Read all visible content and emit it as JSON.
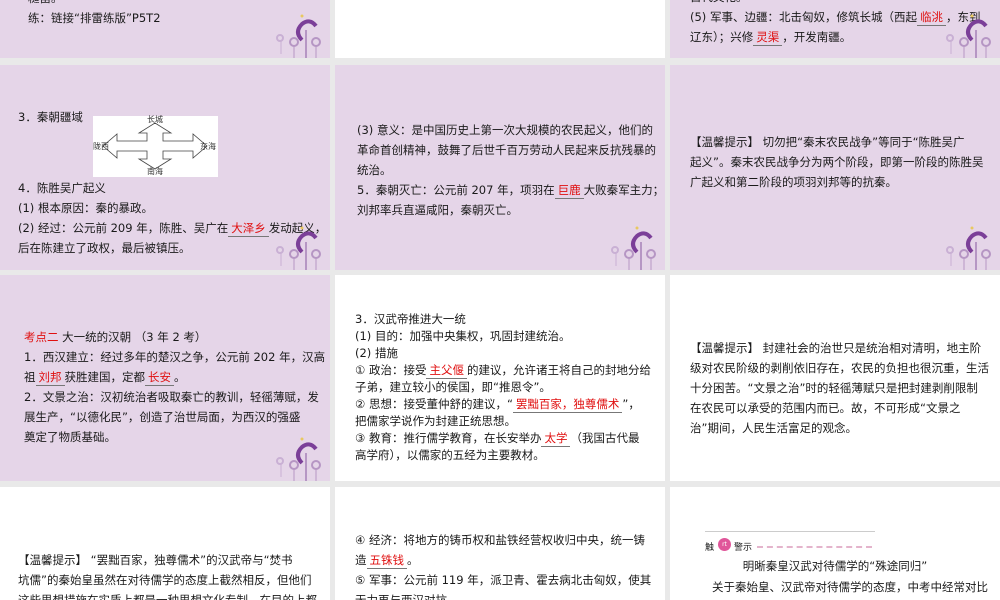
{
  "cells": {
    "r1c1": {
      "lines": [
        [
          {
            "t": "糙笛。"
          }
        ],
        [
          {
            "t": "练：链接“排雷练版”P5T2"
          }
        ]
      ]
    },
    "r1c3": {
      "lines": [
        [
          {
            "t": "古代文化。"
          }
        ],
        [
          {
            "t": "(5) 军事、边疆：北击匈奴，修筑长城（西起"
          },
          {
            "t": "临洮",
            "blank": true
          },
          {
            "t": "，东到"
          }
        ],
        [
          {
            "t": "辽东）；兴修"
          },
          {
            "t": "灵渠",
            "blank": true
          },
          {
            "t": "，开发南疆。"
          }
        ]
      ]
    },
    "r2c1": {
      "lines_top": [
        [
          {
            "t": "3．秦朝疆域"
          }
        ]
      ],
      "map": {
        "north": "长城",
        "west": "陇西",
        "east": "东海",
        "south": "南海"
      },
      "lines": [
        [
          {
            "t": "4．陈胜吴广起义"
          }
        ],
        [
          {
            "t": "(1) 根本原因：秦的暴政。"
          }
        ],
        [
          {
            "t": "(2) 经过：公元前 209 年，陈胜、吴广在"
          },
          {
            "t": "大泽乡",
            "blank": true
          },
          {
            "t": "发动起义，"
          }
        ],
        [
          {
            "t": "后在陈建立了政权，最后被镇压。"
          }
        ]
      ]
    },
    "r2c2": {
      "lines": [
        [
          {
            "t": "(3) 意义：是中国历史上第一次大规模的农民起义，他们的"
          }
        ],
        [
          {
            "t": "革命首创精神，鼓舞了后世千百万劳动人民起来反抗残暴的"
          }
        ],
        [
          {
            "t": "统治。"
          }
        ],
        [
          {
            "t": "5．秦朝灭亡：公元前 207 年，项羽在"
          },
          {
            "t": "巨鹿",
            "blank": true
          },
          {
            "t": "大败秦军主力；"
          }
        ],
        [
          {
            "t": "刘邦率兵直逼咸阳，秦朝灭亡。"
          }
        ]
      ]
    },
    "r2c3": {
      "lines": [
        [
          {
            "t": "【温馨提示】 切勿把“秦末农民战争”等同于“陈胜吴广"
          }
        ],
        [
          {
            "t": "起义”。秦末农民战争分为两个阶段，即第一阶段的陈胜吴"
          }
        ],
        [
          {
            "t": "广起义和第二阶段的项羽刘邦等的抗秦。"
          }
        ]
      ]
    },
    "r3c1": {
      "lines": [
        [
          {
            "t": "考点二",
            "red": true
          },
          {
            "t": " 大一统的汉朝  （3 年 2 考）"
          }
        ],
        [
          {
            "t": "1．西汉建立：经过多年的楚汉之争，公元前 202 年，汉高"
          }
        ],
        [
          {
            "t": "祖"
          },
          {
            "t": "刘邦",
            "blank": true
          },
          {
            "t": "获胜建国，定都"
          },
          {
            "t": "长安",
            "blank": true
          },
          {
            "t": "。"
          }
        ],
        [
          {
            "t": "2．文景之治：汉初统治者吸取秦亡的教训，轻徭薄赋，发"
          }
        ],
        [
          {
            "t": "展生产，“以德化民”，创造了治世局面，为西汉的强盛"
          }
        ],
        [
          {
            "t": "奠定了物质基础。"
          }
        ]
      ]
    },
    "r3c2": {
      "lines": [
        [
          {
            "t": "3．汉武帝推进大一统"
          }
        ],
        [
          {
            "t": "(1) 目的：加强中央集权，巩固封建统治。"
          }
        ],
        [
          {
            "t": "(2) 措施"
          }
        ],
        [
          {
            "t": "① 政治：接受"
          },
          {
            "t": "主父偃",
            "blank": true
          },
          {
            "t": "的建议，允许诸王将自己的封地分给"
          }
        ],
        [
          {
            "t": "子弟，建立较小的侯国，即“推恩令”。"
          }
        ],
        [
          {
            "t": "② 思想：接受董仲舒的建议，“"
          },
          {
            "t": "罢黜百家，独尊儒术",
            "blank": true
          },
          {
            "t": "”，"
          }
        ],
        [
          {
            "t": "把儒家学说作为封建正统思想。"
          }
        ],
        [
          {
            "t": "③ 教育：推行儒学教育，在长安举办"
          },
          {
            "t": "太学",
            "blank": true
          },
          {
            "t": "（我国古代最"
          }
        ],
        [
          {
            "t": "高学府），以儒家的五经为主要教材。"
          }
        ]
      ]
    },
    "r3c3": {
      "lines": [
        [
          {
            "t": "【温馨提示】 封建社会的治世只是统治相对清明，地主阶"
          }
        ],
        [
          {
            "t": "级对农民阶级的剥削依旧存在，农民的负担也很沉重，生活"
          }
        ],
        [
          {
            "t": "十分困苦。“文景之治”时的轻徭薄赋只是把封建剥削限制"
          }
        ],
        [
          {
            "t": "在农民可以承受的范围内而已。故，不可形成“文景之"
          }
        ],
        [
          {
            "t": "治”期间，人民生活富足的观念。"
          }
        ]
      ]
    },
    "r4c1": {
      "lines": [
        [
          {
            "t": "【温馨提示】 “罢黜百家，独尊儒术”的汉武帝与“焚书"
          }
        ],
        [
          {
            "t": "坑儒”的秦始皇虽然在对待儒学的态度上截然相反，但他们"
          }
        ],
        [
          {
            "t": "这些思想措施在实质上都是一种思想文化专制，在目的上都"
          }
        ]
      ]
    },
    "r4c2": {
      "lines": [
        [
          {
            "t": "④ 经济：将地方的铸币权和盐铁经营权收归中央，统一铸"
          }
        ],
        [
          {
            "t": "造"
          },
          {
            "t": "五铢钱",
            "blank": true
          },
          {
            "t": "。"
          }
        ],
        [
          {
            "t": "⑤ 军事：公元前 119 年，派卫青、霍去病北击匈奴，使其"
          }
        ],
        [
          {
            "t": "无力再与西汉对抗。"
          }
        ]
      ]
    },
    "r4c3": {
      "header_left": "触",
      "header_badge": "rt",
      "header_right": "警示",
      "title": "明晰秦皇汉武对待儒学的“殊途同归”",
      "lines": [
        [
          {
            "t": "关于秦始皇、汉武帝对待儒学的态度，中考中经常对比"
          }
        ]
      ]
    }
  },
  "colors": {
    "lilac": "#e5d5e8",
    "answer_red": "#e01010",
    "gap": "#e9e9e9"
  }
}
